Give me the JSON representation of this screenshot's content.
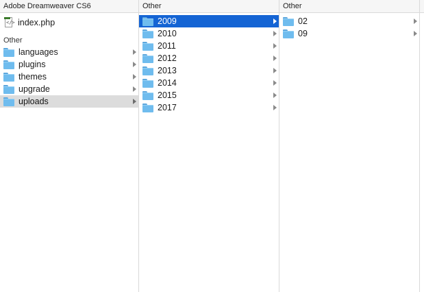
{
  "columns": [
    {
      "header": "Adobe Dreamweaver CS6",
      "file": {
        "name": "index.php",
        "icon": "php-file-icon"
      },
      "section_label": "Other",
      "items": [
        {
          "label": "languages",
          "icon": "folder-icon",
          "has_children": true,
          "state": ""
        },
        {
          "label": "plugins",
          "icon": "folder-icon",
          "has_children": true,
          "state": ""
        },
        {
          "label": "themes",
          "icon": "folder-icon",
          "has_children": true,
          "state": ""
        },
        {
          "label": "upgrade",
          "icon": "folder-icon",
          "has_children": true,
          "state": ""
        },
        {
          "label": "uploads",
          "icon": "folder-icon",
          "has_children": true,
          "state": "selected-inactive"
        }
      ]
    },
    {
      "header": "Other",
      "items": [
        {
          "label": "2009",
          "icon": "folder-icon",
          "has_children": true,
          "state": "selected-active"
        },
        {
          "label": "2010",
          "icon": "folder-icon",
          "has_children": true,
          "state": ""
        },
        {
          "label": "2011",
          "icon": "folder-icon",
          "has_children": true,
          "state": ""
        },
        {
          "label": "2012",
          "icon": "folder-icon",
          "has_children": true,
          "state": ""
        },
        {
          "label": "2013",
          "icon": "folder-icon",
          "has_children": true,
          "state": ""
        },
        {
          "label": "2014",
          "icon": "folder-icon",
          "has_children": true,
          "state": ""
        },
        {
          "label": "2015",
          "icon": "folder-icon",
          "has_children": true,
          "state": ""
        },
        {
          "label": "2017",
          "icon": "folder-icon",
          "has_children": true,
          "state": ""
        }
      ]
    },
    {
      "header": "Other",
      "items": [
        {
          "label": "02",
          "icon": "folder-icon",
          "has_children": true,
          "state": ""
        },
        {
          "label": "09",
          "icon": "folder-icon",
          "has_children": true,
          "state": ""
        }
      ]
    }
  ],
  "colors": {
    "selection_active": "#1464d4",
    "selection_inactive": "#dcdcdc",
    "folder": "#6fbcee"
  }
}
